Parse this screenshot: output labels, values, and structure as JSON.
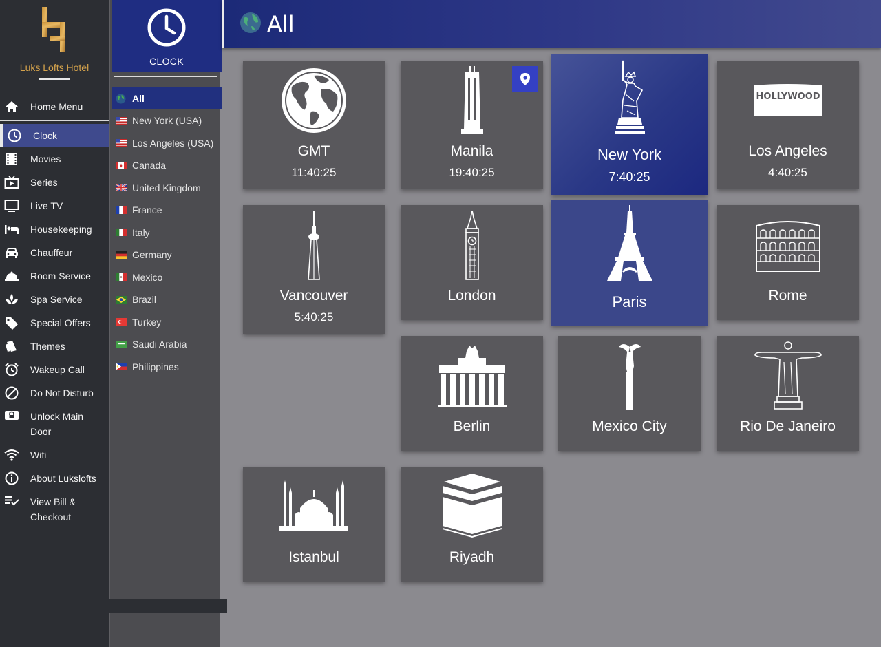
{
  "app": {
    "hotel_name": "Luks Lofts Hotel",
    "section_title": "CLOCK"
  },
  "sidebar": {
    "home": {
      "label": "Home Menu",
      "icon": "home-icon"
    },
    "items": [
      {
        "label": "Clock",
        "icon": "clock-icon",
        "active": true
      },
      {
        "label": "Movies",
        "icon": "film-icon"
      },
      {
        "label": "Series",
        "icon": "tv-play-icon"
      },
      {
        "label": "Live TV",
        "icon": "monitor-icon"
      },
      {
        "label": "Housekeeping",
        "icon": "bed-icon"
      },
      {
        "label": "Chauffeur",
        "icon": "car-icon"
      },
      {
        "label": "Room Service",
        "icon": "cloche-icon"
      },
      {
        "label": "Spa Service",
        "icon": "lotus-icon"
      },
      {
        "label": "Special Offers",
        "icon": "tag-icon"
      },
      {
        "label": "Themes",
        "icon": "paint-icon"
      },
      {
        "label": "Wakeup Call",
        "icon": "alarm-icon"
      },
      {
        "label": "Do Not Disturb",
        "icon": "block-icon"
      },
      {
        "label": "Unlock Main Door",
        "icon": "lock-icon"
      },
      {
        "label": "Wifi",
        "icon": "wifi-icon"
      },
      {
        "label": "About Lukslofts",
        "icon": "info-icon"
      },
      {
        "label": "View Bill & Checkout",
        "icon": "checklist-icon"
      }
    ]
  },
  "countries": [
    {
      "label": "All",
      "flag": "globe",
      "active": true
    },
    {
      "label": "New York (USA)",
      "flag": "us"
    },
    {
      "label": "Los Angeles (USA)",
      "flag": "us"
    },
    {
      "label": "Canada",
      "flag": "ca"
    },
    {
      "label": "United Kingdom",
      "flag": "uk"
    },
    {
      "label": "France",
      "flag": "fr"
    },
    {
      "label": "Italy",
      "flag": "it"
    },
    {
      "label": "Germany",
      "flag": "de"
    },
    {
      "label": "Mexico",
      "flag": "mx"
    },
    {
      "label": "Brazil",
      "flag": "br"
    },
    {
      "label": "Turkey",
      "flag": "tr"
    },
    {
      "label": "Saudi Arabia",
      "flag": "sa"
    },
    {
      "label": "Philippines",
      "flag": "ph"
    }
  ],
  "header": {
    "title": "All",
    "icon": "globe-icon"
  },
  "tiles": [
    {
      "city": "GMT",
      "time": "11:40:25",
      "icon": "globe-icon"
    },
    {
      "city": "Manila",
      "time": "19:40:25",
      "icon": "tower-icon",
      "pinned": true
    },
    {
      "city": "New York",
      "time": "7:40:25",
      "icon": "statue-of-liberty-icon",
      "state": "focused"
    },
    {
      "city": "Los Angeles",
      "time": "4:40:25",
      "icon": "hollywood-sign-icon",
      "sign_text": "HOLLYWOOD"
    },
    {
      "city": "Vancouver",
      "time": "5:40:25",
      "icon": "cn-tower-icon"
    },
    {
      "city": "London",
      "time": "",
      "icon": "big-ben-icon"
    },
    {
      "city": "Paris",
      "time": "",
      "icon": "eiffel-tower-icon",
      "state": "hovered"
    },
    {
      "city": "Rome",
      "time": "",
      "icon": "colosseum-icon"
    },
    {
      "city": "Berlin",
      "time": "",
      "icon": "brandenburg-gate-icon"
    },
    {
      "city": "Mexico City",
      "time": "",
      "icon": "angel-of-independence-icon"
    },
    {
      "city": "Rio De Janeiro",
      "time": "",
      "icon": "christ-the-redeemer-icon"
    },
    {
      "city": "Istanbul",
      "time": "",
      "icon": "mosque-icon"
    },
    {
      "city": "Riyadh",
      "time": "",
      "icon": "kaaba-icon"
    }
  ],
  "colors": {
    "accent": "#21307f",
    "hotel_gold": "#d4a24c",
    "sidebar_bg": "#2c2e33",
    "tile_bg": "#59585c",
    "pin_badge": "#3440c4"
  }
}
